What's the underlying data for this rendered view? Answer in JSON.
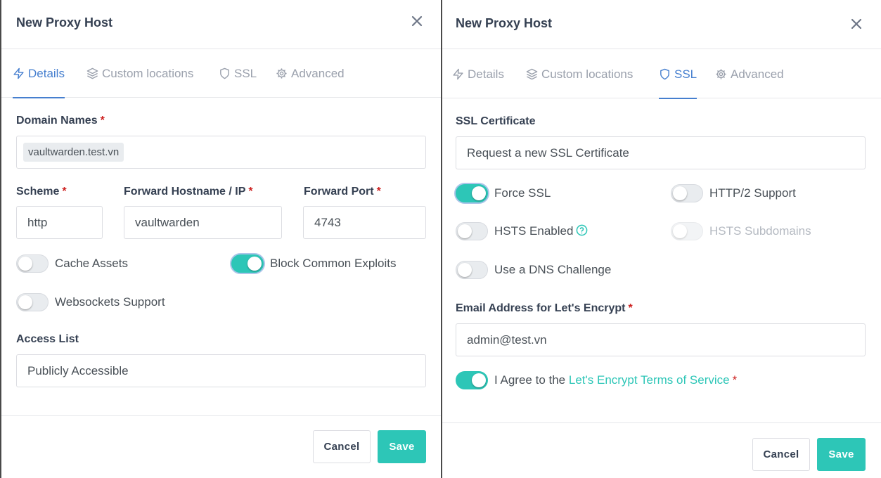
{
  "left_modal": {
    "title": "New Proxy Host",
    "tabs": [
      {
        "label": "Details",
        "icon": "zap-icon",
        "active": true
      },
      {
        "label": "Custom locations",
        "icon": "layers-icon",
        "active": false
      },
      {
        "label": "SSL",
        "icon": "shield-icon",
        "active": false
      },
      {
        "label": "Advanced",
        "icon": "gear-icon",
        "active": false
      }
    ],
    "domain_names": {
      "label": "Domain Names",
      "required": "*",
      "value": "vaultwarden.test.vn"
    },
    "scheme": {
      "label": "Scheme",
      "required": "*",
      "value": "http"
    },
    "forward_host": {
      "label": "Forward Hostname / IP",
      "required": "*",
      "value": "vaultwarden"
    },
    "forward_port": {
      "label": "Forward Port",
      "required": "*",
      "value": "4743"
    },
    "cache_assets": {
      "label": "Cache Assets",
      "on": false
    },
    "block_exploits": {
      "label": "Block Common Exploits",
      "on": true
    },
    "websockets": {
      "label": "Websockets Support",
      "on": false
    },
    "access_list": {
      "label": "Access List",
      "value": "Publicly Accessible"
    },
    "cancel_label": "Cancel",
    "save_label": "Save"
  },
  "right_modal": {
    "title": "New Proxy Host",
    "tabs": [
      {
        "label": "Details",
        "icon": "zap-icon",
        "active": false
      },
      {
        "label": "Custom locations",
        "icon": "layers-icon",
        "active": false
      },
      {
        "label": "SSL",
        "icon": "shield-icon",
        "active": true
      },
      {
        "label": "Advanced",
        "icon": "gear-icon",
        "active": false
      }
    ],
    "ssl_certificate": {
      "label": "SSL Certificate",
      "value": "Request a new SSL Certificate"
    },
    "force_ssl": {
      "label": "Force SSL",
      "on": true
    },
    "http2": {
      "label": "HTTP/2 Support",
      "on": false
    },
    "hsts": {
      "label": "HSTS Enabled",
      "on": false
    },
    "hsts_sub": {
      "label": "HSTS Subdomains",
      "on": false,
      "disabled": true
    },
    "dns_challenge": {
      "label": "Use a DNS Challenge",
      "on": false
    },
    "email": {
      "label": "Email Address for Let's Encrypt",
      "required": "*",
      "value": "admin@test.vn"
    },
    "agree": {
      "prefix": "I Agree to the",
      "link": "Let's Encrypt Terms of Service",
      "required": "*",
      "on": true
    },
    "cancel_label": "Cancel",
    "save_label": "Save"
  },
  "colors": {
    "accent": "#2dc6b7",
    "active_tab": "#467fcf",
    "required": "#cd201f"
  }
}
